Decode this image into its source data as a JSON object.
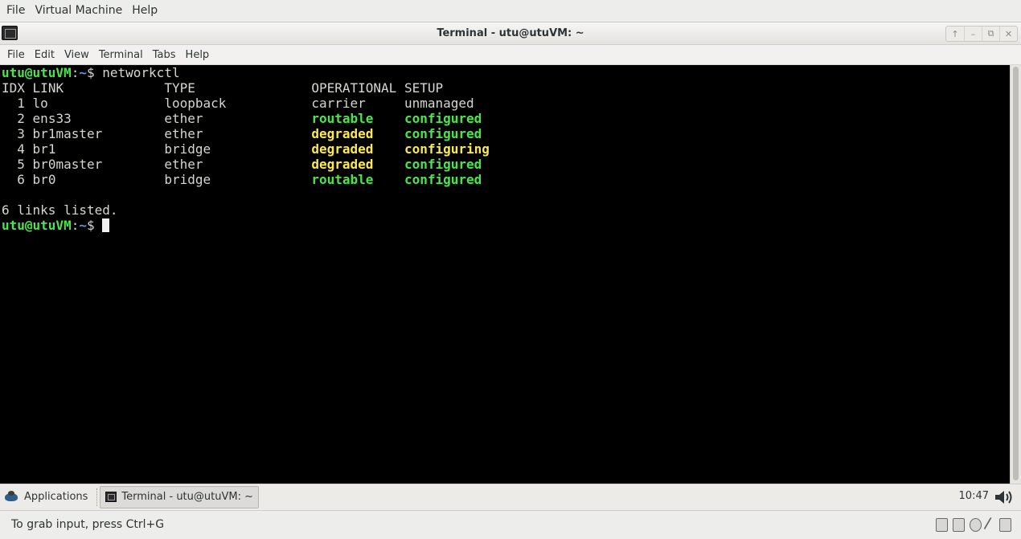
{
  "host_menu": [
    "File",
    "Virtual Machine",
    "Help"
  ],
  "window": {
    "title": "Terminal - utu@utuVM: ~",
    "controls": [
      "↑",
      "–",
      "⧉",
      "✕"
    ]
  },
  "terminal_menu": [
    "File",
    "Edit",
    "View",
    "Terminal",
    "Tabs",
    "Help"
  ],
  "terminal": {
    "prompt_user": "utu@utuVM",
    "prompt_sep": ":",
    "prompt_dir": "~",
    "prompt_sym": "$ ",
    "command": "networkctl",
    "header": {
      "idx": "IDX",
      "link": "LINK",
      "type": "TYPE",
      "operational": "OPERATIONAL",
      "setup": "SETUP"
    },
    "rows": [
      {
        "idx": "1",
        "link": "lo",
        "type": "loopback",
        "operational": "carrier",
        "setup": "unmanaged",
        "op_style": "n",
        "setup_style": "n"
      },
      {
        "idx": "2",
        "link": "ens33",
        "type": "ether",
        "operational": "routable",
        "setup": "configured",
        "op_style": "g",
        "setup_style": "g"
      },
      {
        "idx": "3",
        "link": "br1master",
        "type": "ether",
        "operational": "degraded",
        "setup": "configured",
        "op_style": "y",
        "setup_style": "g"
      },
      {
        "idx": "4",
        "link": "br1",
        "type": "bridge",
        "operational": "degraded",
        "setup": "configuring",
        "op_style": "y",
        "setup_style": "y"
      },
      {
        "idx": "5",
        "link": "br0master",
        "type": "ether",
        "operational": "degraded",
        "setup": "configured",
        "op_style": "y",
        "setup_style": "g"
      },
      {
        "idx": "6",
        "link": "br0",
        "type": "bridge",
        "operational": "routable",
        "setup": "configured",
        "op_style": "g",
        "setup_style": "g"
      }
    ],
    "footer": "6 links listed."
  },
  "taskbar": {
    "apps_label": "Applications",
    "task_label": "Terminal - utu@utuVM: ~",
    "clock": "10:47"
  },
  "statusbar": {
    "message": "To grab input, press Ctrl+G"
  },
  "colors": {
    "green": "#4ce44c",
    "blue": "#6c8fe0",
    "yellow": "#fce94f",
    "terminal_bg": "#000000"
  }
}
